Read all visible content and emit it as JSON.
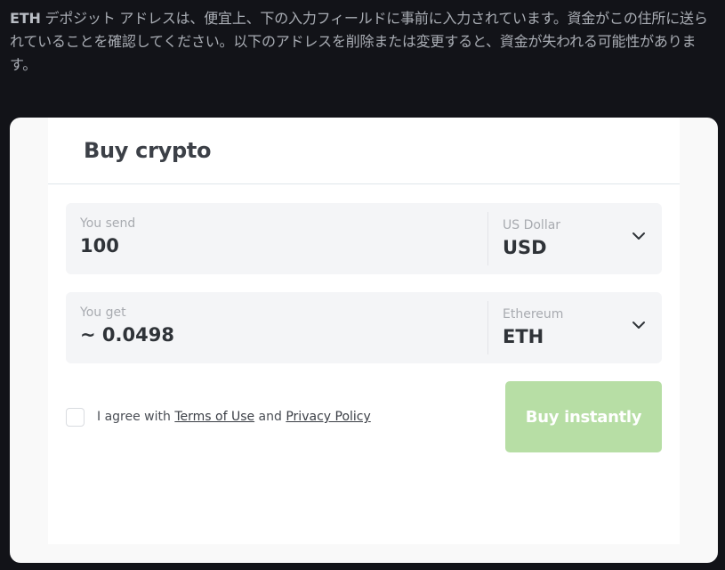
{
  "notice": {
    "coin": "ETH",
    "text": " デポジット アドレスは、便宜上、下の入力フィールドに事前に入力されています。資金がこの住所に送られていることを確認してください。以下のアドレスを削除または変更すると、資金が失われる可能性があります。"
  },
  "widget": {
    "title": "Buy crypto",
    "send": {
      "label": "You send",
      "value": "100",
      "currency_name": "US Dollar",
      "currency_code": "USD"
    },
    "get": {
      "label": "You get",
      "value": "~ 0.0498",
      "currency_name": "Ethereum",
      "currency_code": "ETH"
    },
    "agreement": {
      "checked": false,
      "prefix": "I agree with ",
      "terms_link": "Terms of Use",
      "conjunction": " and ",
      "privacy_link": "Privacy Policy"
    },
    "buy_button_label": "Buy instantly",
    "buy_button_color": "#b7dea5"
  }
}
